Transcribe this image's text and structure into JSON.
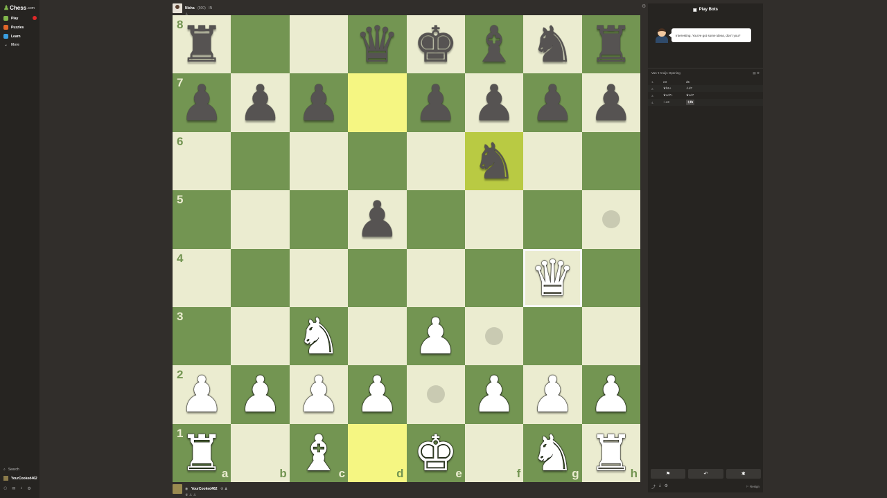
{
  "nav": {
    "logo": "Chess",
    "logo_tld": ".com",
    "items": [
      {
        "label": "Play",
        "color": "#81b64c",
        "badge": true
      },
      {
        "label": "Puzzles",
        "color": "#e0662a",
        "badge": false
      },
      {
        "label": "Learn",
        "color": "#3a9ee0",
        "badge": false
      },
      {
        "label": "More",
        "color": "#999999",
        "badge": false
      }
    ],
    "search_label": "Search",
    "username": "YourCooked462"
  },
  "opponent": {
    "name": "Nisha",
    "rating": "(500)",
    "flag": "IN"
  },
  "player": {
    "name": "YourCooked462",
    "badges": "⚙ ♟"
  },
  "board": {
    "ranks": [
      "8",
      "7",
      "6",
      "5",
      "4",
      "3",
      "2",
      "1"
    ],
    "files": [
      "a",
      "b",
      "c",
      "d",
      "e",
      "f",
      "g",
      "h"
    ],
    "rows": [
      [
        "r",
        "",
        "",
        "q",
        "k",
        "b",
        "n",
        "r"
      ],
      [
        "p",
        "p",
        "p",
        "",
        "p",
        "p",
        "p",
        "p"
      ],
      [
        "",
        "",
        "",
        "",
        "",
        "n",
        "",
        ""
      ],
      [
        "",
        "",
        "",
        "p",
        "",
        "",
        "",
        ""
      ],
      [
        "",
        "",
        "",
        "",
        "",
        "",
        "Q",
        ""
      ],
      [
        "",
        "",
        "N",
        "",
        "P",
        "",
        "",
        ""
      ],
      [
        "P",
        "P",
        "P",
        "P",
        "",
        "P",
        "P",
        "P"
      ],
      [
        "R",
        "",
        "B",
        "",
        "K",
        "",
        "N",
        "R"
      ]
    ],
    "highlight_squares": [
      "d7",
      "f6",
      "d1"
    ],
    "hover_square": "g4",
    "hint_squares": [
      "h5",
      "f3",
      "e2"
    ],
    "colors": {
      "light": "#ebecd0",
      "dark": "#739552",
      "hl_light": "#f5f682",
      "hl_dark": "#b9ca43"
    }
  },
  "panel": {
    "title": "Play Bots",
    "bot_message": "Interesting. You've got some ideas, don't you?",
    "opening": "Van 't Kruijs Opening",
    "moves": [
      {
        "num": "1.",
        "white": "e3",
        "black": "d5"
      },
      {
        "num": "2.",
        "white": "♛h5+",
        "black": "♙d7"
      },
      {
        "num": "3.",
        "white": "♛xd7+",
        "black": "♛xd7"
      },
      {
        "num": "4.",
        "white": "♘c3",
        "black": "♘f6"
      }
    ],
    "resign_label": "Resign"
  }
}
